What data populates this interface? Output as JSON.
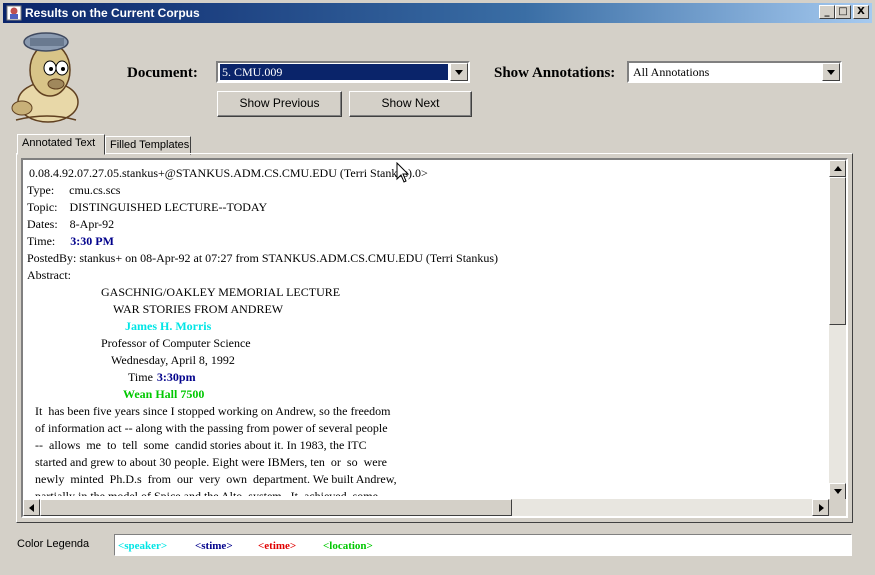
{
  "window": {
    "title": "Results on the Current Corpus",
    "controls": [
      "_",
      "□",
      "X"
    ]
  },
  "header": {
    "document_label": "Document:",
    "document_value": "5. CMU.009",
    "annotations_label": "Show Annotations:",
    "annotations_value": "All Annotations",
    "prev_button": "Show Previous",
    "next_button": "Show Next"
  },
  "tabs": [
    {
      "label": "Annotated Text",
      "active": true
    },
    {
      "label": "Filled Templates",
      "active": false
    }
  ],
  "document": {
    "lines": [
      {
        "text": "0.08.4.92.07.27.05.stankus+@STANKUS.ADM.CS.CMU.EDU (Terri Stankus).0>",
        "indent": 2,
        "style": "plain"
      },
      {
        "text": "Type:     cmu.cs.scs",
        "indent": 0,
        "style": "plain"
      },
      {
        "text": "Topic:    DISTINGUISHED LECTURE--TODAY",
        "indent": 0,
        "style": "plain"
      },
      {
        "text": "Dates:    8-Apr-92",
        "indent": 0,
        "style": "plain"
      },
      {
        "text": "Time:",
        "indent": 0,
        "style": "plain",
        "extra": "3:30 PM",
        "extra_style": "stime"
      },
      {
        "text": "PostedBy: stankus+ on 08-Apr-92 at 07:27 from STANKUS.ADM.CS.CMU.EDU (Terri Stankus)",
        "indent": 0,
        "style": "plain"
      },
      {
        "text": "Abstract:",
        "indent": 0,
        "style": "plain"
      },
      {
        "text": "GASCHNIG/OAKLEY MEMORIAL LECTURE",
        "indent": 74,
        "style": "plain"
      },
      {
        "text": "WAR STORIES FROM ANDREW",
        "indent": 86,
        "style": "plain"
      },
      {
        "text": "James H. Morris",
        "indent": 98,
        "style": "speaker"
      },
      {
        "text": "Professor of Computer Science",
        "indent": 74,
        "style": "plain"
      },
      {
        "text": "Wednesday, April 8, 1992",
        "indent": 84,
        "style": "plain"
      },
      {
        "text": "Time",
        "indent": 101,
        "style": "plain",
        "extra": "3:30pm",
        "extra_style": "stime"
      },
      {
        "text": "Wean Hall 7500",
        "indent": 96,
        "style": "location"
      },
      {
        "text": "It  has been five years since I stopped working on Andrew, so the freedom",
        "indent": 8,
        "style": "plain"
      },
      {
        "text": "of information act -- along with the passing from power of several people",
        "indent": 8,
        "style": "plain"
      },
      {
        "text": "--  allows  me  to  tell  some  candid stories about it. In 1983, the ITC",
        "indent": 8,
        "style": "plain"
      },
      {
        "text": "started and grew to about 30 people. Eight were IBMers, ten  or  so  were",
        "indent": 8,
        "style": "plain"
      },
      {
        "text": "newly  minted  Ph.D.s  from  our  very  own  department. We built Andrew,",
        "indent": 8,
        "style": "plain"
      },
      {
        "text": "partially in the model of Spice and the Alto  system.  It  achieved  some",
        "indent": 8,
        "style": "plain"
      }
    ]
  },
  "legend": {
    "label": "Color Legenda",
    "items": [
      {
        "text": "<speaker>",
        "color": "#00e5e5"
      },
      {
        "text": "<stime>",
        "color": "#00008b"
      },
      {
        "text": "<etime>",
        "color": "#e00000"
      },
      {
        "text": "<location>",
        "color": "#00c800"
      }
    ]
  },
  "colors": {
    "speaker": "#00e5e5",
    "stime": "#00008b",
    "location": "#00c800",
    "selection": "#0a246a"
  }
}
